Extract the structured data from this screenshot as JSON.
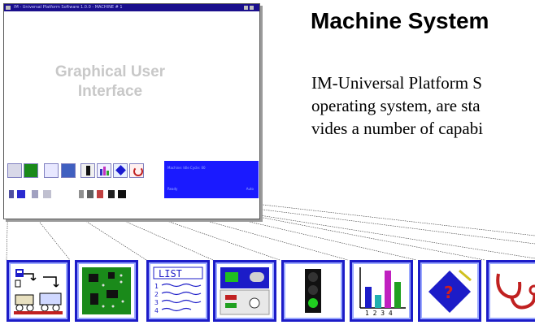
{
  "window": {
    "title": "IM - Universal Platform Software 1.0.0 - MACHINE # 1",
    "watermark_line1": "Graphical User",
    "watermark_line2": "Interface",
    "status_panel": {
      "line1": "Machine: Idle  Cycle: 00",
      "line2": "Ready",
      "line3": "Auto"
    }
  },
  "heading": "Machine System",
  "body_lines": [
    "IM-Universal Platform S",
    "operating system, are sta",
    "vides a number of capabi"
  ],
  "icons": [
    {
      "name": "machine-diagram-icon",
      "label": "Machine Diagram"
    },
    {
      "name": "circuit-board-icon",
      "label": "I/O Board"
    },
    {
      "name": "list-icon",
      "label": "LIST"
    },
    {
      "name": "control-panel-icon",
      "label": "Control Panel"
    },
    {
      "name": "traffic-light-icon",
      "label": "Status"
    },
    {
      "name": "bar-chart-icon",
      "label": "1 2 3 4"
    },
    {
      "name": "help-book-icon",
      "label": "?"
    },
    {
      "name": "stethoscope-icon",
      "label": "Diagnostics"
    }
  ],
  "colors": {
    "title_bar": "#1a0f8c",
    "icon_border": "#1c1cc8",
    "status_panel": "#1a1aff",
    "watermark": "#c8c8c8"
  }
}
